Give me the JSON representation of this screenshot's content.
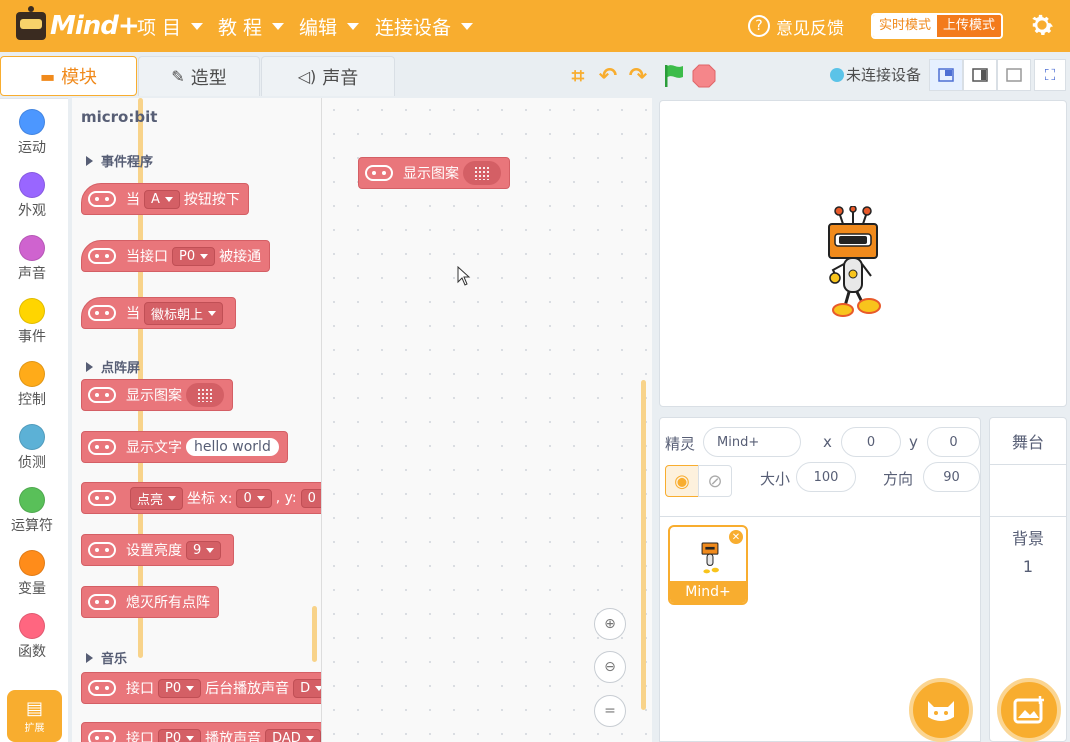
{
  "app": {
    "brand": "Mind+"
  },
  "menu": {
    "project": "项 目",
    "tutorial": "教 程",
    "edit": "编辑",
    "connect": "连接设备",
    "feedback": "意见反馈",
    "mode_realtime": "实时模式",
    "mode_upload": "上传模式"
  },
  "tabs": {
    "blocks": "模块",
    "costumes": "造型",
    "sounds": "声音"
  },
  "status": {
    "connection": "未连接设备"
  },
  "categories": [
    "运动",
    "外观",
    "声音",
    "事件",
    "控制",
    "侦测",
    "运算符",
    "变量",
    "函数"
  ],
  "category_colors": [
    "#4c97ff",
    "#9966ff",
    "#cf63cf",
    "#ffd500",
    "#ffab19",
    "#5cb1d6",
    "#59c059",
    "#ff8c1a",
    "#ff6680"
  ],
  "extension_label": "扩展",
  "palette": {
    "title": "micro:bit",
    "section_events": "事件程序",
    "section_matrix": "点阵屏",
    "section_music": "音乐",
    "b1": {
      "prefix": "当",
      "dd": "A",
      "suffix": "按钮按下"
    },
    "b2": {
      "prefix": "当接口",
      "dd": "P0",
      "suffix": "被接通"
    },
    "b3": {
      "prefix": "当",
      "dd": "徽标朝上"
    },
    "b4": {
      "label": "显示图案"
    },
    "b5": {
      "label": "显示文字",
      "text": "hello world"
    },
    "b6": {
      "dd": "点亮",
      "label": "坐标 x:",
      "x": "0",
      "y_label": ", y:",
      "y": "0"
    },
    "b7": {
      "label": "设置亮度",
      "dd": "9"
    },
    "b8": {
      "label": "熄灭所有点阵"
    },
    "b9": {
      "prefix": "接口",
      "dd": "P0",
      "suffix": "后台播放声音",
      "tail": "D"
    },
    "b10": {
      "prefix": "接口",
      "dd": "P0",
      "suffix": "播放声音",
      "tail": "DAD"
    }
  },
  "workspace": {
    "block_label": "显示图案"
  },
  "sprite": {
    "label_sprite": "精灵",
    "name": "Mind+",
    "x_label": "x",
    "x": "0",
    "y_label": "y",
    "y": "0",
    "size_label": "大小",
    "size": "100",
    "direction_label": "方向",
    "direction": "90",
    "thumb_name": "Mind+"
  },
  "stage_panel": {
    "title": "舞台",
    "backdrops_label": "背景",
    "backdrops_count": "1"
  }
}
